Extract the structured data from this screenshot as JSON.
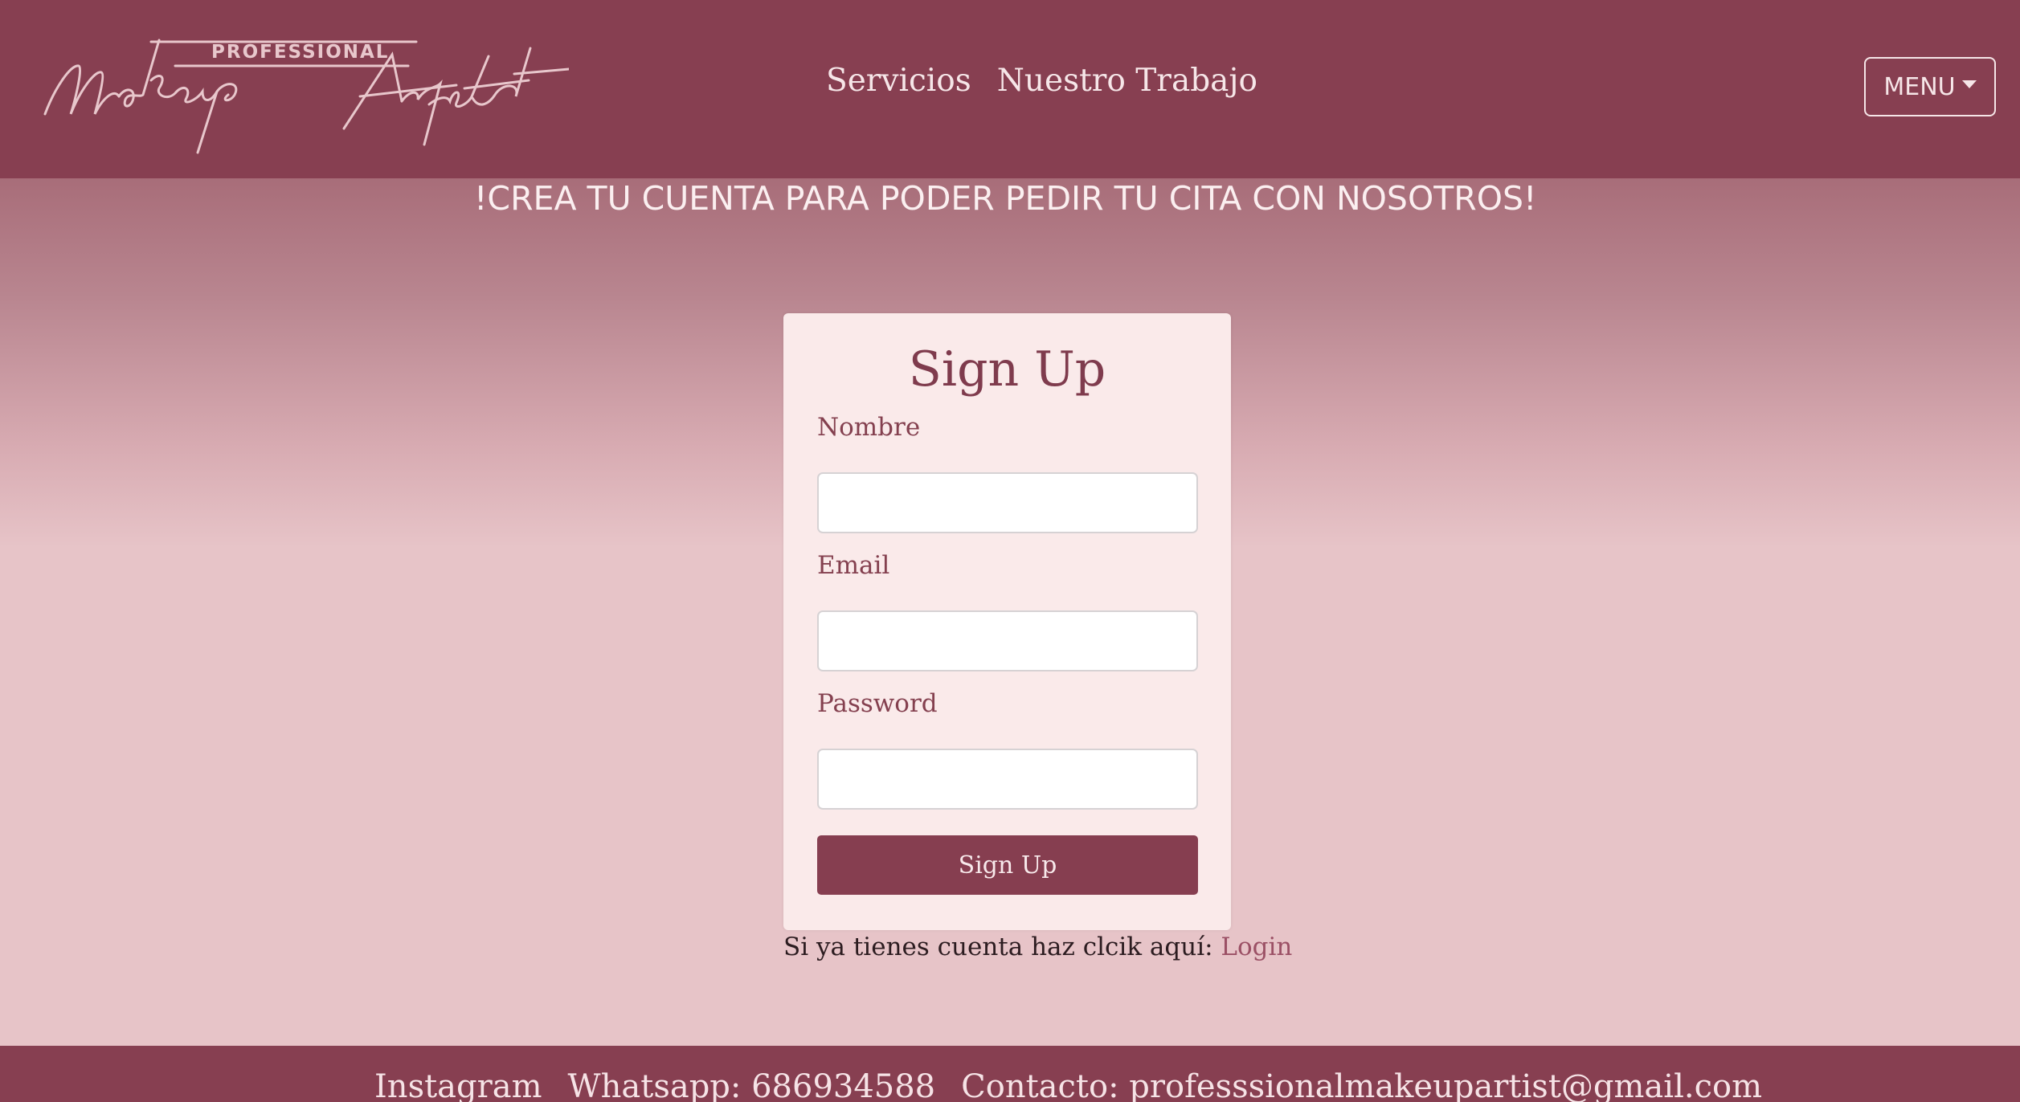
{
  "header": {
    "logo": {
      "top_text": "PROFESSIONAL",
      "script_text": "Makeup Artist"
    },
    "nav": [
      "Servicios",
      "Nuestro Trabajo"
    ],
    "menu_label": "MENU"
  },
  "main": {
    "headline": "!CREA TU CUENTA PARA PODER PEDIR TU CITA CON NOSOTROS!",
    "form": {
      "title": "Sign Up",
      "fields": [
        {
          "label": "Nombre",
          "value": ""
        },
        {
          "label": "Email",
          "value": ""
        },
        {
          "label": "Password",
          "value": ""
        }
      ],
      "submit_label": "Sign Up"
    },
    "login_prompt": "Si ya tienes cuenta haz clcik aquí: ",
    "login_link": "Login"
  },
  "footer": {
    "instagram": "Instagram",
    "whatsapp": "Whatsapp: 686934588",
    "contact": "Contacto: professsionalmakeupartist@gmail.com"
  },
  "colors": {
    "brand": "#873f51",
    "card_bg": "#faeaea",
    "page_bg": "#e7c4c8"
  }
}
